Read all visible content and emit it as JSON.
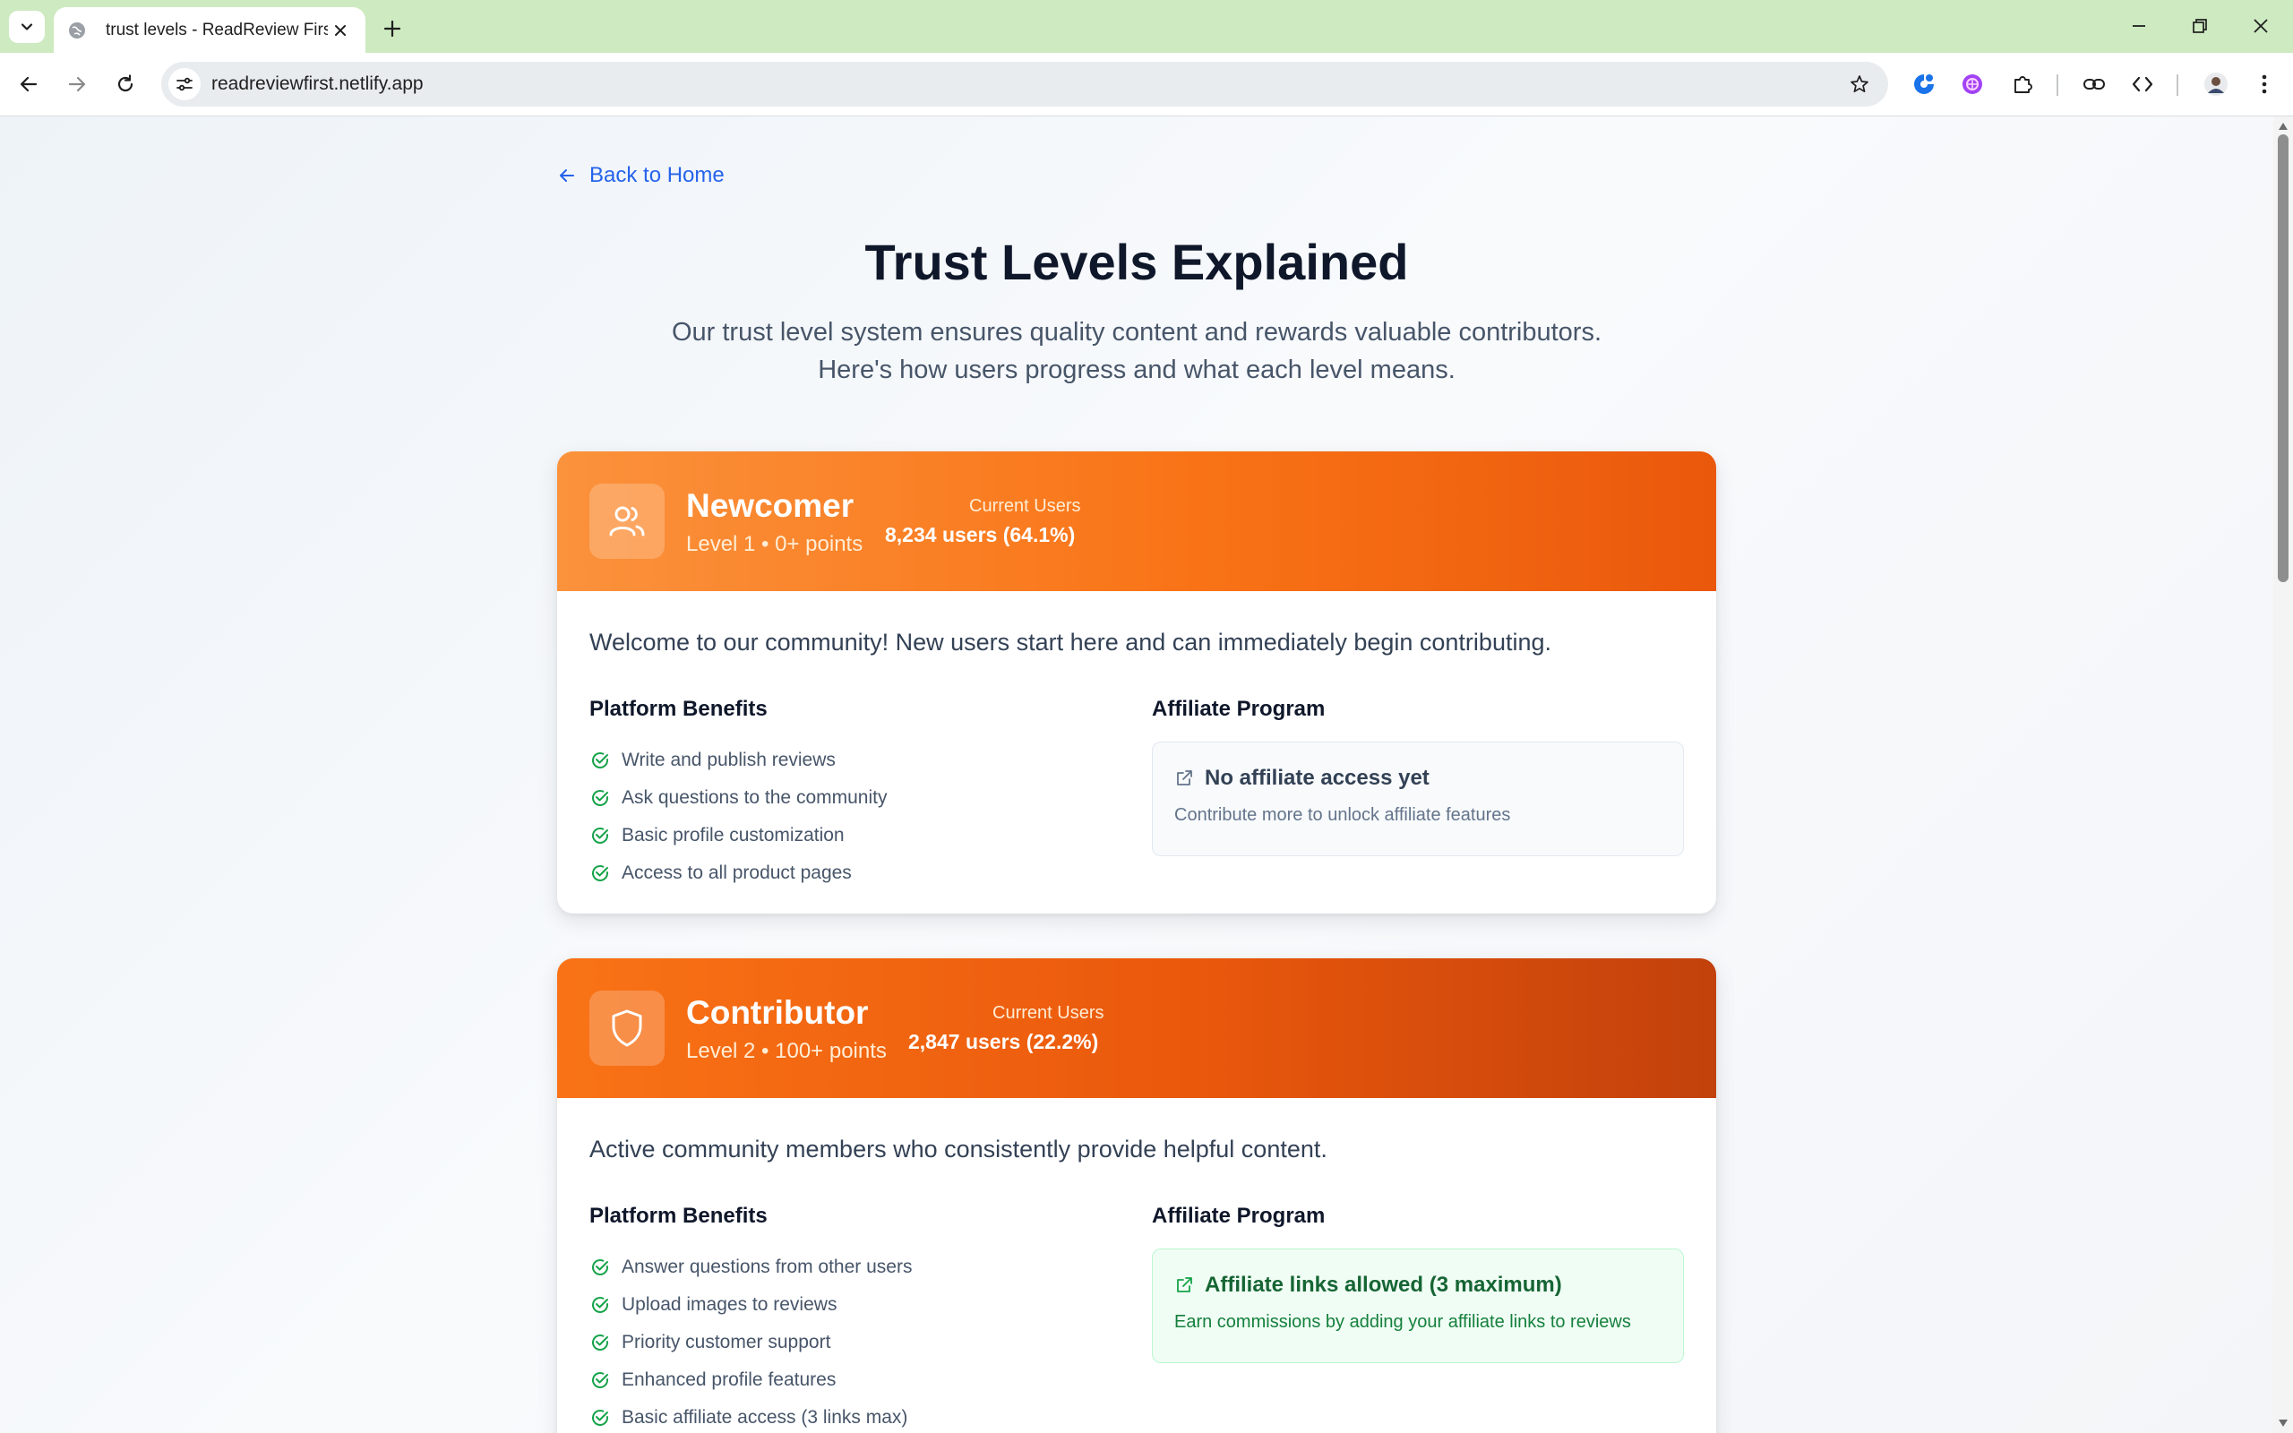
{
  "browser": {
    "tab_title": "trust levels - ReadReview First",
    "url": "readreviewfirst.netlify.app"
  },
  "page": {
    "back_link": "Back to Home",
    "title": "Trust Levels Explained",
    "subtitle_line1": "Our trust level system ensures quality content and rewards valuable contributors.",
    "subtitle_line2": "Here's how users progress and what each level means."
  },
  "levels": [
    {
      "icon": "users-icon",
      "name": "Newcomer",
      "meta": "Level 1 • 0+ points",
      "users_label": "Current Users",
      "users_value": "8,234 users (64.1%)",
      "description": "Welcome to our community! New users start here and can immediately begin contributing.",
      "benefits_title": "Platform Benefits",
      "benefits": [
        "Write and publish reviews",
        "Ask questions to the community",
        "Basic profile customization",
        "Access to all product pages"
      ],
      "affiliate_title": "Affiliate Program",
      "affiliate_status": "No affiliate access yet",
      "affiliate_note": "Contribute more to unlock affiliate features"
    },
    {
      "icon": "shield-icon",
      "name": "Contributor",
      "meta": "Level 2 • 100+ points",
      "users_label": "Current Users",
      "users_value": "2,847 users (22.2%)",
      "description": "Active community members who consistently provide helpful content.",
      "benefits_title": "Platform Benefits",
      "benefits": [
        "Answer questions from other users",
        "Upload images to reviews",
        "Priority customer support",
        "Enhanced profile features",
        "Basic affiliate access (3 links max)"
      ],
      "affiliate_title": "Affiliate Program",
      "affiliate_status": "Affiliate links allowed (3 maximum)",
      "affiliate_note": "Earn commissions by adding your affiliate links to reviews"
    }
  ]
}
